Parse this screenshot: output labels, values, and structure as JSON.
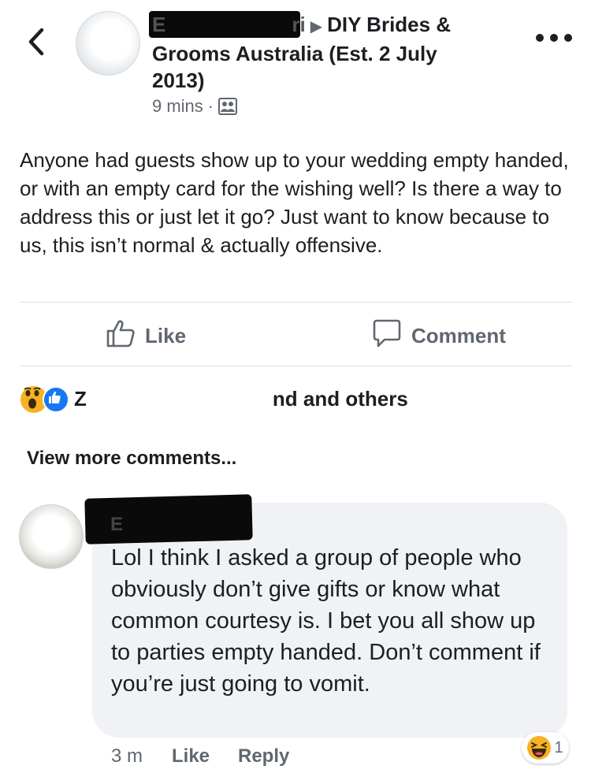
{
  "header": {
    "back_icon": "chevron-left-icon",
    "author_visible_start": "E",
    "author_visible_end": "ri",
    "group_name": "DIY Brides & Grooms Australia (Est. 2 July 2013)",
    "timestamp": "9 mins",
    "separator": "·",
    "privacy_icon": "group-members-icon",
    "more_icon": "more-horizontal-icon"
  },
  "post": {
    "text": "Anyone had guests show up to your wedding empty handed, or with an empty card for the wishing well? Is there a way to address this or just let it go? Just want to know because to us, this isn’t normal & actually offensive."
  },
  "actions": {
    "like_label": "Like",
    "like_icon": "thumbs-up-icon",
    "comment_label": "Comment",
    "comment_icon": "comment-bubble-icon"
  },
  "reactions": {
    "icons": [
      "wow-reaction-icon",
      "like-reaction-icon"
    ],
    "name_visible_start": "Z",
    "name_visible_end": "nd and others"
  },
  "comments": {
    "view_more": "View more comments...",
    "items": [
      {
        "author_visible": "E",
        "text": "Lol I think I asked a group of people who obviously don’t give gifts or know what common courtesy is. I bet you all show up to parties empty handed. Don’t comment if you’re just going to vomit.",
        "time": "3 m",
        "like_label": "Like",
        "reply_label": "Reply",
        "reaction_icon": "haha-reaction-icon",
        "reaction_count": "1"
      }
    ]
  },
  "colors": {
    "text": "#1c1e21",
    "secondary": "#606770",
    "divider": "#dadde1",
    "bubble": "#f0f2f5",
    "like_blue": "#1877f2",
    "reaction_yellow": "#f7b125"
  }
}
